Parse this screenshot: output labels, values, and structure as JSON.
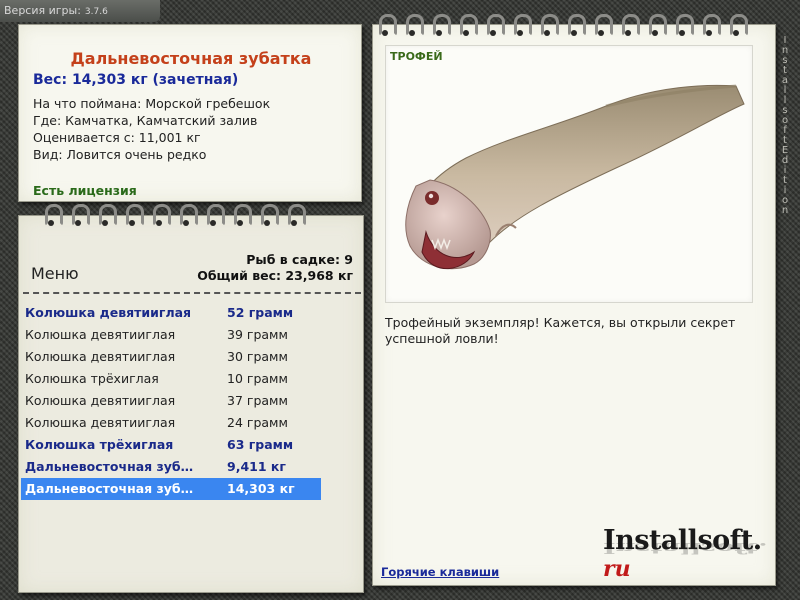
{
  "version": {
    "label": "Версия игры:",
    "number": "3.7.6"
  },
  "fish_info": {
    "name": "Дальневосточная зубатка",
    "weight": "Вес: 14,303 кг (зачетная)",
    "lines": [
      "На что поймана: Морской гребешок",
      "Где: Камчатка, Камчатский залив",
      "Оценивается с: 11,001 кг",
      "Вид: Ловится очень редко"
    ],
    "license": "Есть лицензия"
  },
  "menu": {
    "title": "Меню",
    "fish_count": "Рыб в садке: 9",
    "total_weight": "Общий вес: 23,968 кг",
    "items": [
      {
        "name": "Колюшка девятииглая",
        "weight": "52 грамм",
        "bold": true,
        "selected": false
      },
      {
        "name": "Колюшка девятииглая",
        "weight": "39 грамм",
        "bold": false,
        "selected": false
      },
      {
        "name": "Колюшка девятииглая",
        "weight": "30 грамм",
        "bold": false,
        "selected": false
      },
      {
        "name": "Колюшка трёхиглая",
        "weight": "10 грамм",
        "bold": false,
        "selected": false
      },
      {
        "name": "Колюшка девятииглая",
        "weight": "37 грамм",
        "bold": false,
        "selected": false
      },
      {
        "name": "Колюшка девятииглая",
        "weight": "24 грамм",
        "bold": false,
        "selected": false
      },
      {
        "name": "Колюшка трёхиглая",
        "weight": "63 грамм",
        "bold": true,
        "selected": false
      },
      {
        "name": "Дальневосточная зуба...",
        "weight": "9,411 кг",
        "bold": true,
        "selected": false
      },
      {
        "name": "Дальневосточная зуба...",
        "weight": "14,303 кг",
        "bold": true,
        "selected": true
      }
    ]
  },
  "trophy": {
    "badge": "ТРОФЕЙ",
    "text": "Трофейный экземпляр! Кажется, вы открыли секрет успешной ловли!",
    "hotkeys": "Горячие клавиши"
  },
  "brand": {
    "main": "Installsoft.",
    "suffix": "ru"
  },
  "vertical_mark": "InstallsoftEdition",
  "colors": {
    "accent_red": "#c4401a",
    "accent_blue": "#1a2a9a",
    "selection": "#3a86f0",
    "license_green": "#2a6a1a"
  }
}
